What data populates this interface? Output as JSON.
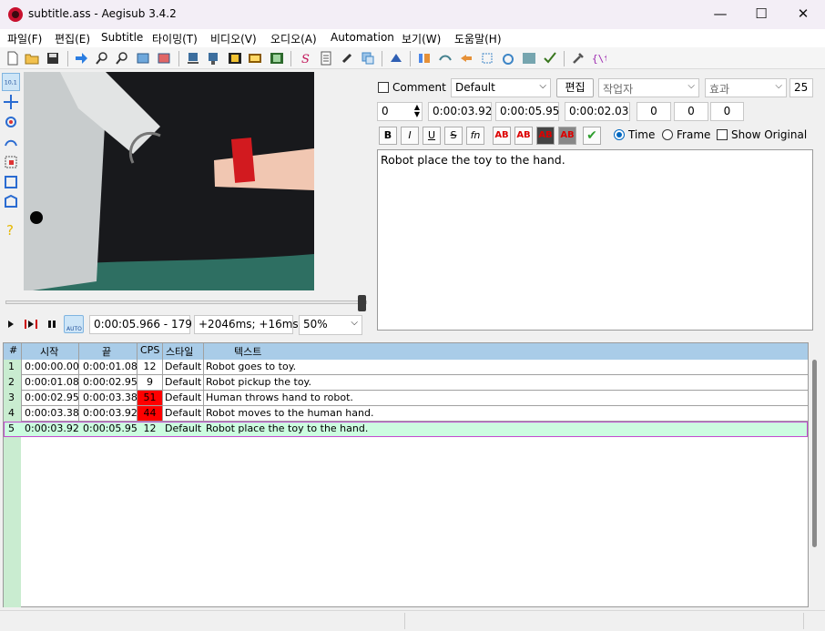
{
  "window": {
    "title": "subtitle.ass - Aegisub 3.4.2",
    "minimize": "—",
    "maximize": "☐",
    "close": "✕"
  },
  "menu": [
    "파일(F)",
    "편집(E)",
    "Subtitle",
    "타이밍(T)",
    "비디오(V)",
    "오디오(A)",
    "Automation",
    "보기(W)",
    "도움말(H)"
  ],
  "toolbar_icons": [
    "new-file-icon",
    "open-file-icon",
    "save-icon",
    "jump-icon",
    "zoom-in-icon",
    "zoom-out-icon",
    "snap-start-icon",
    "snap-end-icon",
    "sort-start-icon",
    "sort-end-icon",
    "keyframes-icon",
    "video-details-icon",
    "spellcheck-icon",
    "styles-manager-icon",
    "script-properties-icon",
    "attachments-icon",
    "fonts-collector-icon",
    "resample-icon",
    "timing-post-processor-icon",
    "kanji-timer-icon",
    "translation-assistant-icon",
    "shift-times-icon",
    "select-lines-icon",
    "ass-checker-icon",
    "auto-mode-icon",
    "options-icon",
    "tags-icon"
  ],
  "video": {
    "time_display": "0:00:05.966 - 179",
    "offset_display": "+2046ms; +16ms",
    "zoom": "50%",
    "auto_label": "AUTO"
  },
  "editor": {
    "comment_label": "Comment",
    "style": "Default",
    "edit_button": "편집",
    "actor_placeholder": "작업자",
    "effect_placeholder": "효과",
    "layer_count": "25",
    "layer": "0",
    "start_time": "0:00:03.92",
    "end_time": "0:00:05.95",
    "duration": "0:00:02.03",
    "margin_l": "0",
    "margin_r": "0",
    "margin_v": "0",
    "bold": "B",
    "italic": "I",
    "underline": "U",
    "strike": "S",
    "fn": "fn",
    "color_ab": "AB",
    "time_label": "Time",
    "frame_label": "Frame",
    "show_original_label": "Show Original",
    "text": "Robot place the toy to the hand."
  },
  "grid": {
    "headers": {
      "num": "#",
      "start": "시작",
      "end": "끝",
      "cps": "CPS",
      "style": "스타일",
      "text": "텍스트"
    },
    "rows": [
      {
        "num": "1",
        "start": "0:00:00.00",
        "end": "0:00:01.08",
        "cps": "12",
        "style": "Default",
        "text": "Robot goes to toy."
      },
      {
        "num": "2",
        "start": "0:00:01.08",
        "end": "0:00:02.95",
        "cps": "9",
        "style": "Default",
        "text": "Robot pickup the toy."
      },
      {
        "num": "3",
        "start": "0:00:02.95",
        "end": "0:00:03.38",
        "cps": "51",
        "style": "Default",
        "text": "Human throws hand to robot."
      },
      {
        "num": "4",
        "start": "0:00:03.38",
        "end": "0:00:03.92",
        "cps": "44",
        "style": "Default",
        "text": "Robot moves to the human hand."
      },
      {
        "num": "5",
        "start": "0:00:03.92",
        "end": "0:00:05.95",
        "cps": "12",
        "style": "Default",
        "text": "Robot place the toy to the hand."
      }
    ]
  },
  "colors": {
    "cps_warning": "#ff0000",
    "selected_row": "#ccfce0",
    "header": "#a9cce8",
    "accent": "#0067c0"
  }
}
